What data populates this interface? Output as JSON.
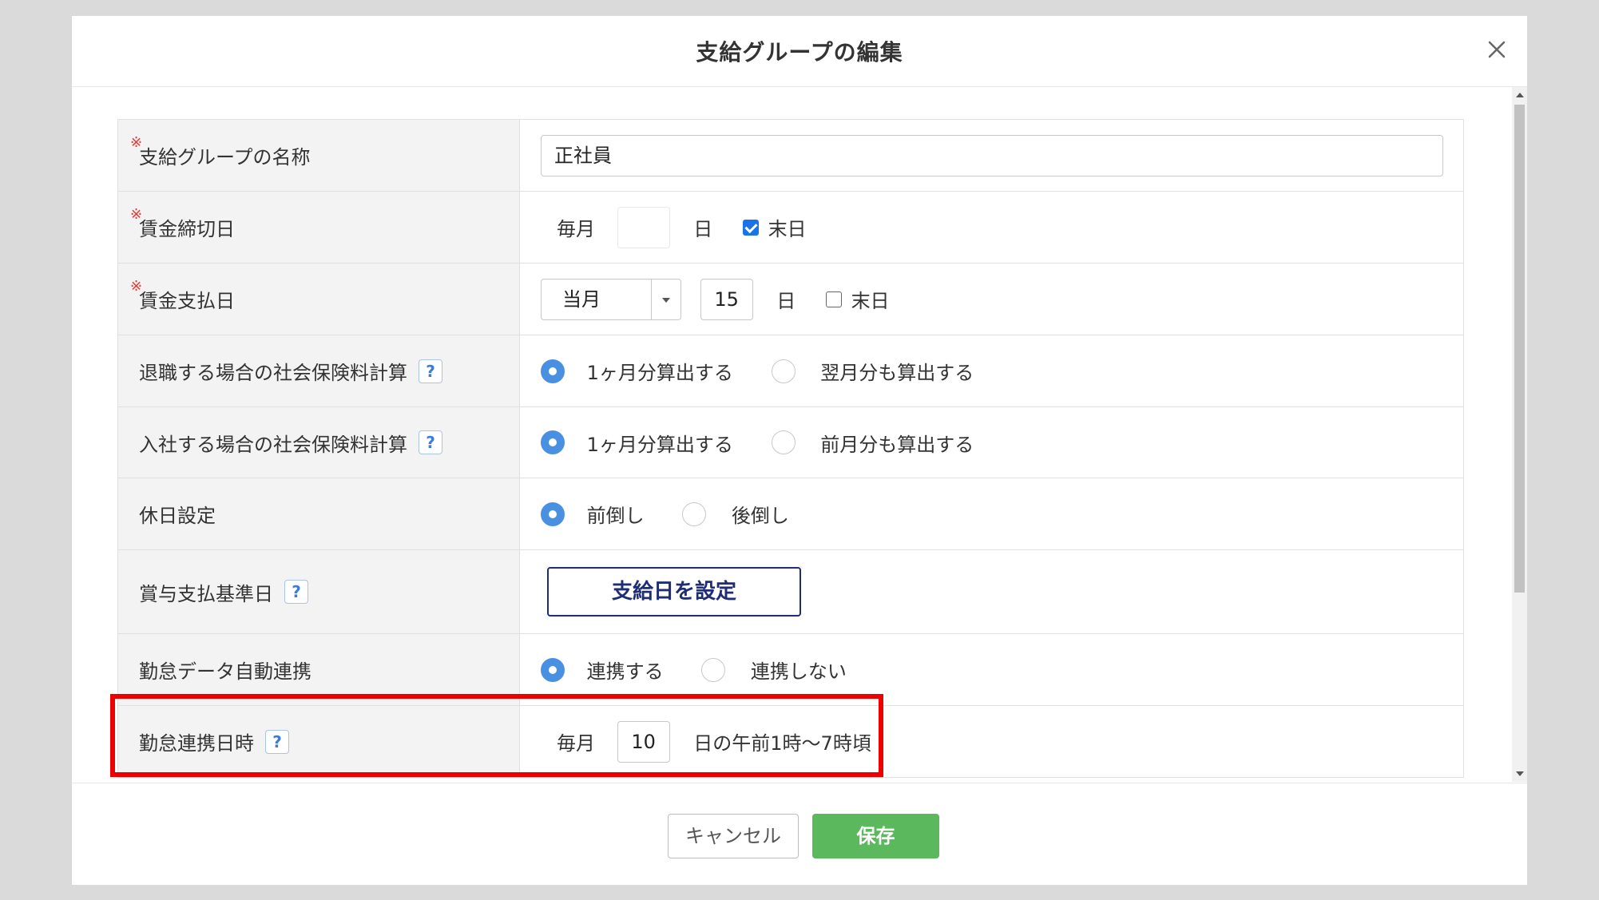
{
  "dialog": {
    "title": "支給グループの編集",
    "close_icon": "close-icon"
  },
  "form": {
    "required_mark": "※",
    "help_mark": "?",
    "group_name": {
      "label": "支給グループの名称",
      "value": "正社員"
    },
    "closing_day": {
      "label": "賃金締切日",
      "prefix": "毎月",
      "day_value": "",
      "day_unit": "日",
      "end_of_month_label": "末日",
      "end_of_month_checked": true
    },
    "payment_day": {
      "label": "賃金支払日",
      "month_select": "当月",
      "day_value": "15",
      "day_unit": "日",
      "end_of_month_label": "末日",
      "end_of_month_checked": false
    },
    "retire_insurance": {
      "label": "退職する場合の社会保険料計算",
      "options": [
        "1ヶ月分算出する",
        "翌月分も算出する"
      ],
      "selected": 0
    },
    "join_insurance": {
      "label": "入社する場合の社会保険料計算",
      "options": [
        "1ヶ月分算出する",
        "前月分も算出する"
      ],
      "selected": 0
    },
    "holiday": {
      "label": "休日設定",
      "options": [
        "前倒し",
        "後倒し"
      ],
      "selected": 0
    },
    "bonus_date": {
      "label": "賞与支払基準日",
      "button_label": "支給日を設定"
    },
    "attendance_sync": {
      "label": "勤怠データ自動連携",
      "options": [
        "連携する",
        "連携しない"
      ],
      "selected": 0
    },
    "sync_datetime": {
      "label": "勤怠連携日時",
      "prefix": "毎月",
      "day_value": "10",
      "suffix": "日の午前1時〜7時頃"
    }
  },
  "footer": {
    "cancel_label": "キャンセル",
    "save_label": "保存",
    "save_color": "#5cb85c"
  },
  "colors": {
    "highlight": "#ee0000",
    "radio_selected": "#4a90e2",
    "bonus_button_border": "#1f2e73"
  }
}
